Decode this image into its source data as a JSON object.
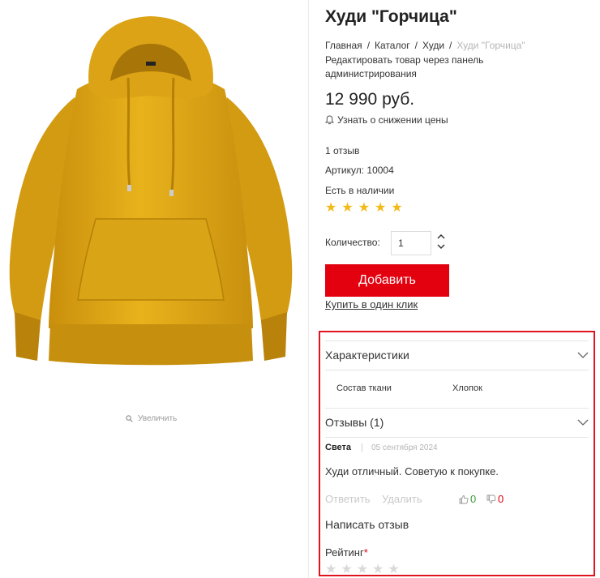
{
  "product": {
    "title": "Худи \"Горчица\"",
    "price": "12 990 руб.",
    "price_alert": "Узнать о снижении цены",
    "reviews_count": "1 отзыв",
    "article": "Артикул: 10004",
    "stock": "Есть в наличии",
    "rating": 5,
    "quantity_label": "Количество:",
    "quantity_value": "1",
    "add_button": "Добавить",
    "one_click": "Купить в один клик",
    "admin_edit": "Редактировать товар через панель администрирования"
  },
  "breadcrumb": [
    "Главная",
    "Каталог",
    "Худи",
    "Худи \"Горчица\""
  ],
  "image": {
    "zoom_label": "Увеличить",
    "hoodie_color": "#e3ab17"
  },
  "tabs": {
    "characteristics": {
      "title": "Характеристики",
      "props": [
        {
          "name": "Состав ткани",
          "value": "Хлопок"
        }
      ]
    },
    "reviews": {
      "title": "Отзывы (1)",
      "items": [
        {
          "author": "Света",
          "date": "05 сентября 2024",
          "text": "Худи отличный. Советую к покупке.",
          "reply": "Ответить",
          "delete": "Удалить",
          "likes": "0",
          "dislikes": "0"
        }
      ],
      "write_review": "Написать отзыв",
      "rating_label": "Рейтинг",
      "required_mark": "*"
    }
  },
  "colors": {
    "accent": "#e3000f",
    "star": "#f5b917",
    "star_empty": "#d9d9d9",
    "panel_outline": "#e0141e"
  }
}
